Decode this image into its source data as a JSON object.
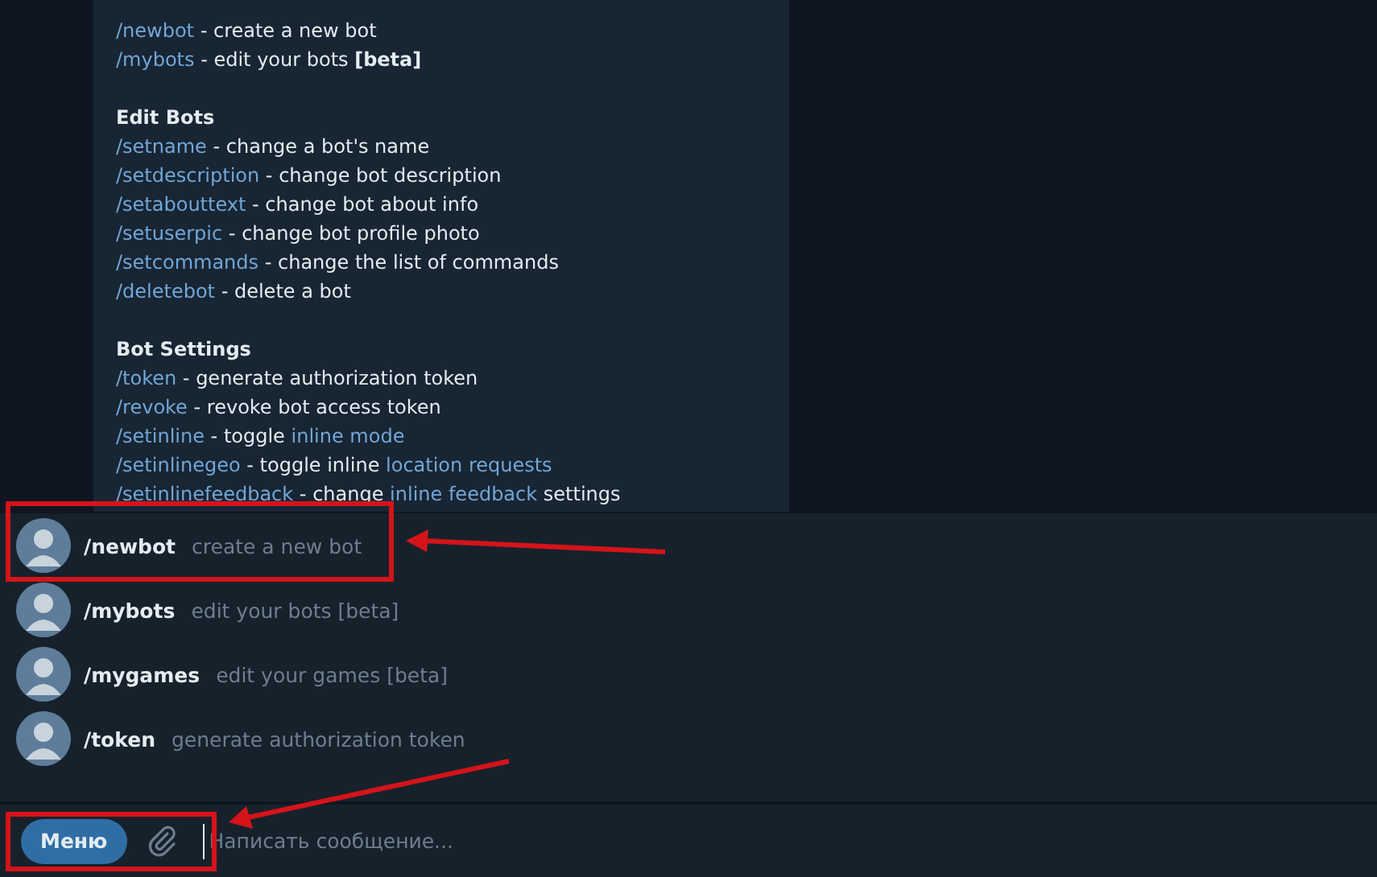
{
  "message": {
    "lines": [
      {
        "kind": "text",
        "parts": [
          {
            "kind": "command",
            "text": "/newbot"
          },
          {
            "kind": "plain",
            "text": " - create a new bot"
          }
        ]
      },
      {
        "kind": "text",
        "parts": [
          {
            "kind": "command",
            "text": "/mybots"
          },
          {
            "kind": "plain",
            "text": " - edit your bots "
          },
          {
            "kind": "bold",
            "text": "[beta]"
          }
        ]
      },
      {
        "kind": "spacer"
      },
      {
        "kind": "heading",
        "parts": [
          {
            "kind": "bold",
            "text": "Edit Bots"
          }
        ]
      },
      {
        "kind": "text",
        "parts": [
          {
            "kind": "command",
            "text": "/setname"
          },
          {
            "kind": "plain",
            "text": " - change a bot's name"
          }
        ]
      },
      {
        "kind": "text",
        "parts": [
          {
            "kind": "command",
            "text": "/setdescription"
          },
          {
            "kind": "plain",
            "text": " - change bot description"
          }
        ]
      },
      {
        "kind": "text",
        "parts": [
          {
            "kind": "command",
            "text": "/setabouttext"
          },
          {
            "kind": "plain",
            "text": " - change bot about info"
          }
        ]
      },
      {
        "kind": "text",
        "parts": [
          {
            "kind": "command",
            "text": "/setuserpic"
          },
          {
            "kind": "plain",
            "text": " - change bot profile photo"
          }
        ]
      },
      {
        "kind": "text",
        "parts": [
          {
            "kind": "command",
            "text": "/setcommands"
          },
          {
            "kind": "plain",
            "text": " - change the list of commands"
          }
        ]
      },
      {
        "kind": "text",
        "parts": [
          {
            "kind": "command",
            "text": "/deletebot"
          },
          {
            "kind": "plain",
            "text": " - delete a bot"
          }
        ]
      },
      {
        "kind": "spacer"
      },
      {
        "kind": "heading",
        "parts": [
          {
            "kind": "bold",
            "text": "Bot Settings"
          }
        ]
      },
      {
        "kind": "text",
        "parts": [
          {
            "kind": "command",
            "text": "/token"
          },
          {
            "kind": "plain",
            "text": " - generate authorization token"
          }
        ]
      },
      {
        "kind": "text",
        "parts": [
          {
            "kind": "command",
            "text": "/revoke"
          },
          {
            "kind": "plain",
            "text": " - revoke bot access token"
          }
        ]
      },
      {
        "kind": "text",
        "parts": [
          {
            "kind": "command",
            "text": "/setinline"
          },
          {
            "kind": "plain",
            "text": " - toggle "
          },
          {
            "kind": "link",
            "text": "inline mode"
          }
        ]
      },
      {
        "kind": "text",
        "parts": [
          {
            "kind": "command",
            "text": "/setinlinegeo"
          },
          {
            "kind": "plain",
            "text": " - toggle inline "
          },
          {
            "kind": "link",
            "text": "location requests"
          }
        ]
      },
      {
        "kind": "text",
        "parts": [
          {
            "kind": "command",
            "text": "/setinlinefeedback"
          },
          {
            "kind": "plain",
            "text": " - change "
          },
          {
            "kind": "link",
            "text": "inline feedback"
          },
          {
            "kind": "plain",
            "text": " settings"
          }
        ]
      }
    ]
  },
  "suggestions": [
    {
      "command": "/newbot",
      "description": "create a new bot"
    },
    {
      "command": "/mybots",
      "description": "edit your bots [beta]"
    },
    {
      "command": "/mygames",
      "description": "edit your games [beta]"
    },
    {
      "command": "/token",
      "description": "generate authorization token"
    }
  ],
  "composer": {
    "menu_button": "Меню",
    "placeholder": "Написать сообщение..."
  }
}
